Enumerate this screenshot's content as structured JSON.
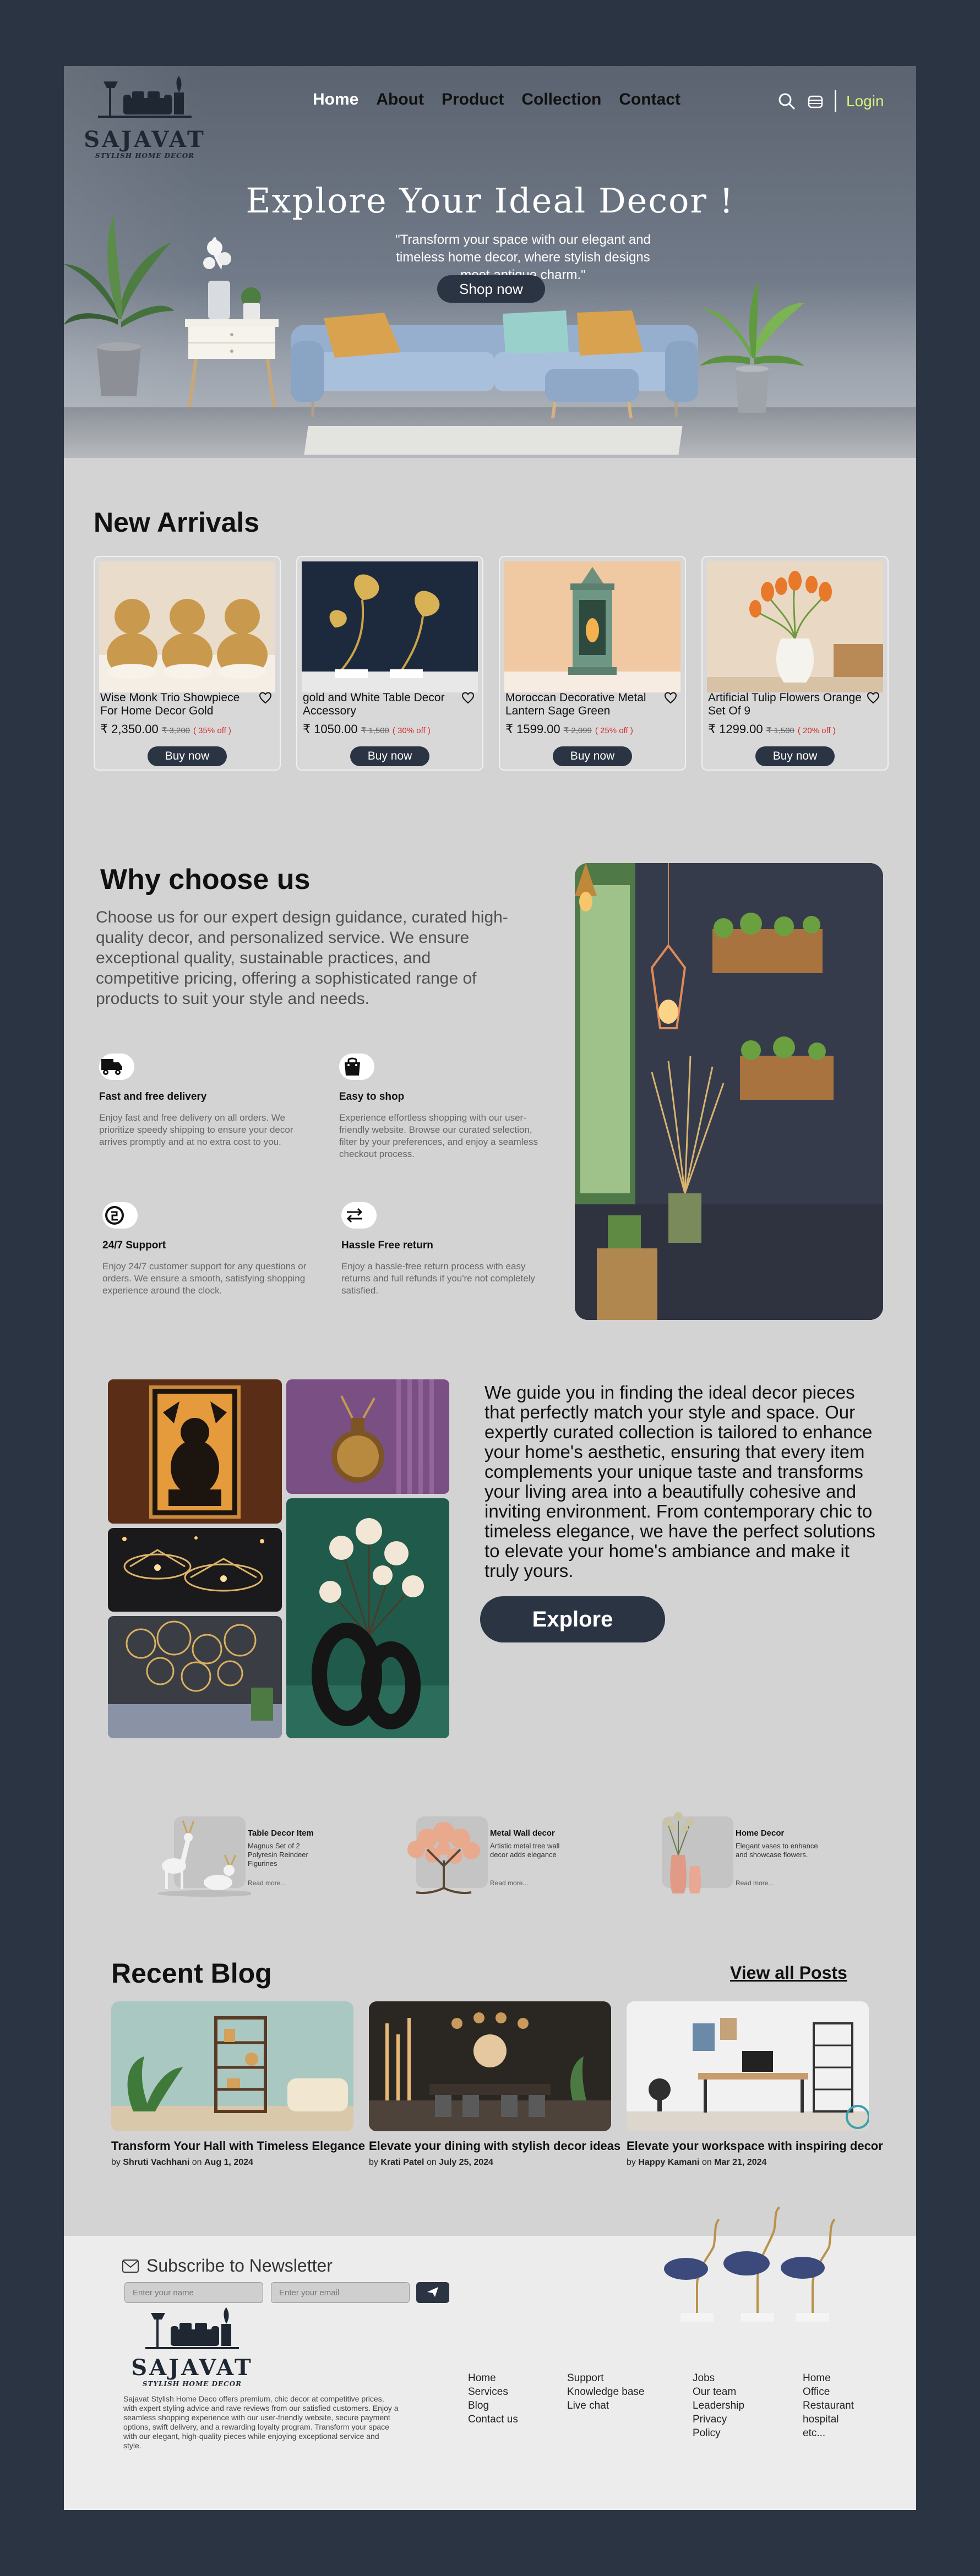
{
  "brand": {
    "name": "SAJAVAT",
    "tagline": "STYLISH HOME DECOR"
  },
  "nav": {
    "items": [
      "Home",
      "About",
      "Product",
      "Collection",
      "Contact"
    ],
    "active": "Home",
    "login": "Login"
  },
  "hero": {
    "title": "Explore Your Ideal Decor !",
    "subtitle": "\"Transform your space with our elegant and timeless home decor, where stylish designs meet antique charm.\"",
    "cta": "Shop now"
  },
  "arrivals": {
    "title": "New Arrivals",
    "buy_label": "Buy now",
    "products": [
      {
        "name": "Wise Monk Trio Showpiece For Home Decor Gold",
        "price": "₹ 2,350.00",
        "old_price": "₹ 3,200",
        "discount": "( 35% off )"
      },
      {
        "name": "gold and White Table Decor Accessory",
        "price": "₹ 1050.00",
        "old_price": "₹ 1,500",
        "discount": "( 30% off )"
      },
      {
        "name": "Moroccan Decorative Metal Lantern Sage Green",
        "price": "₹ 1599.00",
        "old_price": "₹ 2,099",
        "discount": "( 25% off )"
      },
      {
        "name": "Artificial Tulip Flowers Orange Set Of 9",
        "price": "₹ 1299.00",
        "old_price": "₹ 1,500",
        "discount": "( 20% off )"
      }
    ]
  },
  "why": {
    "title": "Why choose us",
    "body": "Choose us for our expert design guidance, curated high-quality decor, and personalized service. We ensure exceptional quality, sustainable practices, and competitive pricing, offering a sophisticated range of products to suit your style and needs.",
    "features": [
      {
        "icon": "truck-icon",
        "title": "Fast and free delivery",
        "desc": "Enjoy fast and free delivery on all orders. We prioritize speedy shipping to ensure your decor arrives promptly and at no extra cost to you."
      },
      {
        "icon": "shopping-bag-icon",
        "title": "Easy to shop",
        "desc": "Experience effortless shopping with our user-friendly website. Browse our curated selection, filter by your preferences, and enjoy a seamless checkout process."
      },
      {
        "icon": "support-icon",
        "title": "24/7 Support",
        "desc": "Enjoy 24/7 customer support for any questions or orders. We ensure a smooth, satisfying shopping experience around the clock."
      },
      {
        "icon": "exchange-icon",
        "title": "Hassle Free return",
        "desc": "Enjoy a hassle-free return process with easy returns and full refunds if you're not completely satisfied."
      }
    ]
  },
  "guide": {
    "text": "We guide you in finding the ideal decor pieces that perfectly match your style and space. Our expertly curated collection is tailored to enhance your home's aesthetic, ensuring that every item complements your unique taste and transforms your living area into a beautifully cohesive and inviting environment. From contemporary chic to timeless elegance, we have the perfect solutions to elevate your home's ambiance and make it truly yours.",
    "cta": "Explore"
  },
  "mini_products": [
    {
      "title": "Table Decor Item",
      "desc": "Magnus Set of 2 Polyresin Reindeer Figurines",
      "more": "Read more..."
    },
    {
      "title": "Metal Wall decor",
      "desc": "Artistic metal tree wall decor adds elegance",
      "more": "Read more..."
    },
    {
      "title": "Home Decor",
      "desc": "Elegant vases to enhance and showcase flowers.",
      "more": "Read more..."
    }
  ],
  "blog": {
    "title": "Recent Blog",
    "view_all": "View all Posts",
    "posts": [
      {
        "title": "Transform Your Hall with Timeless Elegance",
        "by": "by",
        "author": "Shruti Vachhani",
        "on": "on",
        "date": "Aug 1, 2024"
      },
      {
        "title": "Elevate your dining with stylish decor ideas",
        "by": "by",
        "author": "Krati Patel",
        "on": "on",
        "date": "July 25, 2024"
      },
      {
        "title": "Elevate your workspace with inspiring decor",
        "by": "by",
        "author": "Happy Kamani",
        "on": "on",
        "date": "Mar 21, 2024"
      }
    ]
  },
  "footer": {
    "newsletter_title": "Subscribe to Newsletter",
    "name_placeholder": "Enter your name",
    "email_placeholder": "Enter your email",
    "about": "Sajavat Stylish Home Deco offers premium, chic decor at competitive prices, with expert styling advice and rave reviews from our satisfied customers. Enjoy a seamless shopping experience with our user-friendly website, secure payment options, swift delivery, and a rewarding loyalty program. Transform your space with our elegant, high-quality pieces while enjoying exceptional service and style.",
    "columns": [
      [
        "Home",
        "Services",
        "Blog",
        "Contact us"
      ],
      [
        "Support",
        "Knowledge base",
        "Live chat"
      ],
      [
        "Jobs",
        "Our team",
        "Leadership",
        "Privacy",
        "Policy"
      ],
      [
        "Home",
        "Office",
        "Restaurant",
        "hospital",
        "etc..."
      ]
    ]
  },
  "colors": {
    "page_bg": "#2b3443",
    "content_bg": "#d3d3d3",
    "button": "#2b3443",
    "login": "#d9f07a",
    "discount": "#d92a2a",
    "footer_bg": "#ececec"
  }
}
